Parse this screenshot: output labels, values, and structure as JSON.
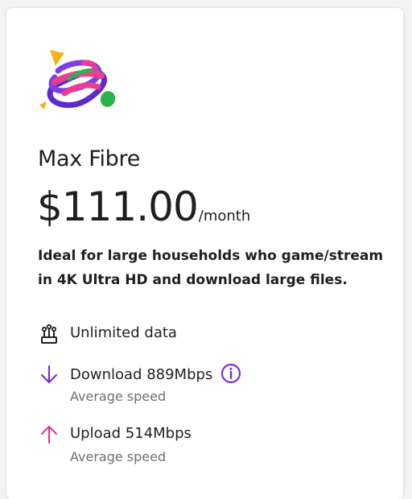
{
  "plan": {
    "name": "Max Fibre",
    "price": "$111.00",
    "period": "/month",
    "description": "Ideal for large households who game/stream in 4K Ultra HD and download large files."
  },
  "features": [
    {
      "icon": "wifi-router-icon",
      "label": "Unlimited data",
      "sublabel": ""
    },
    {
      "icon": "download-arrow-icon",
      "label": "Download 889Mbps",
      "sublabel": "Average speed"
    },
    {
      "icon": "upload-arrow-icon",
      "label": "Upload 514Mbps",
      "sublabel": "Average speed"
    }
  ],
  "colors": {
    "download": "#7b2fd3",
    "upload": "#e8329b",
    "info": "#7b2fd3",
    "text": "#1f1f1f",
    "muted": "#6f6f6f"
  }
}
